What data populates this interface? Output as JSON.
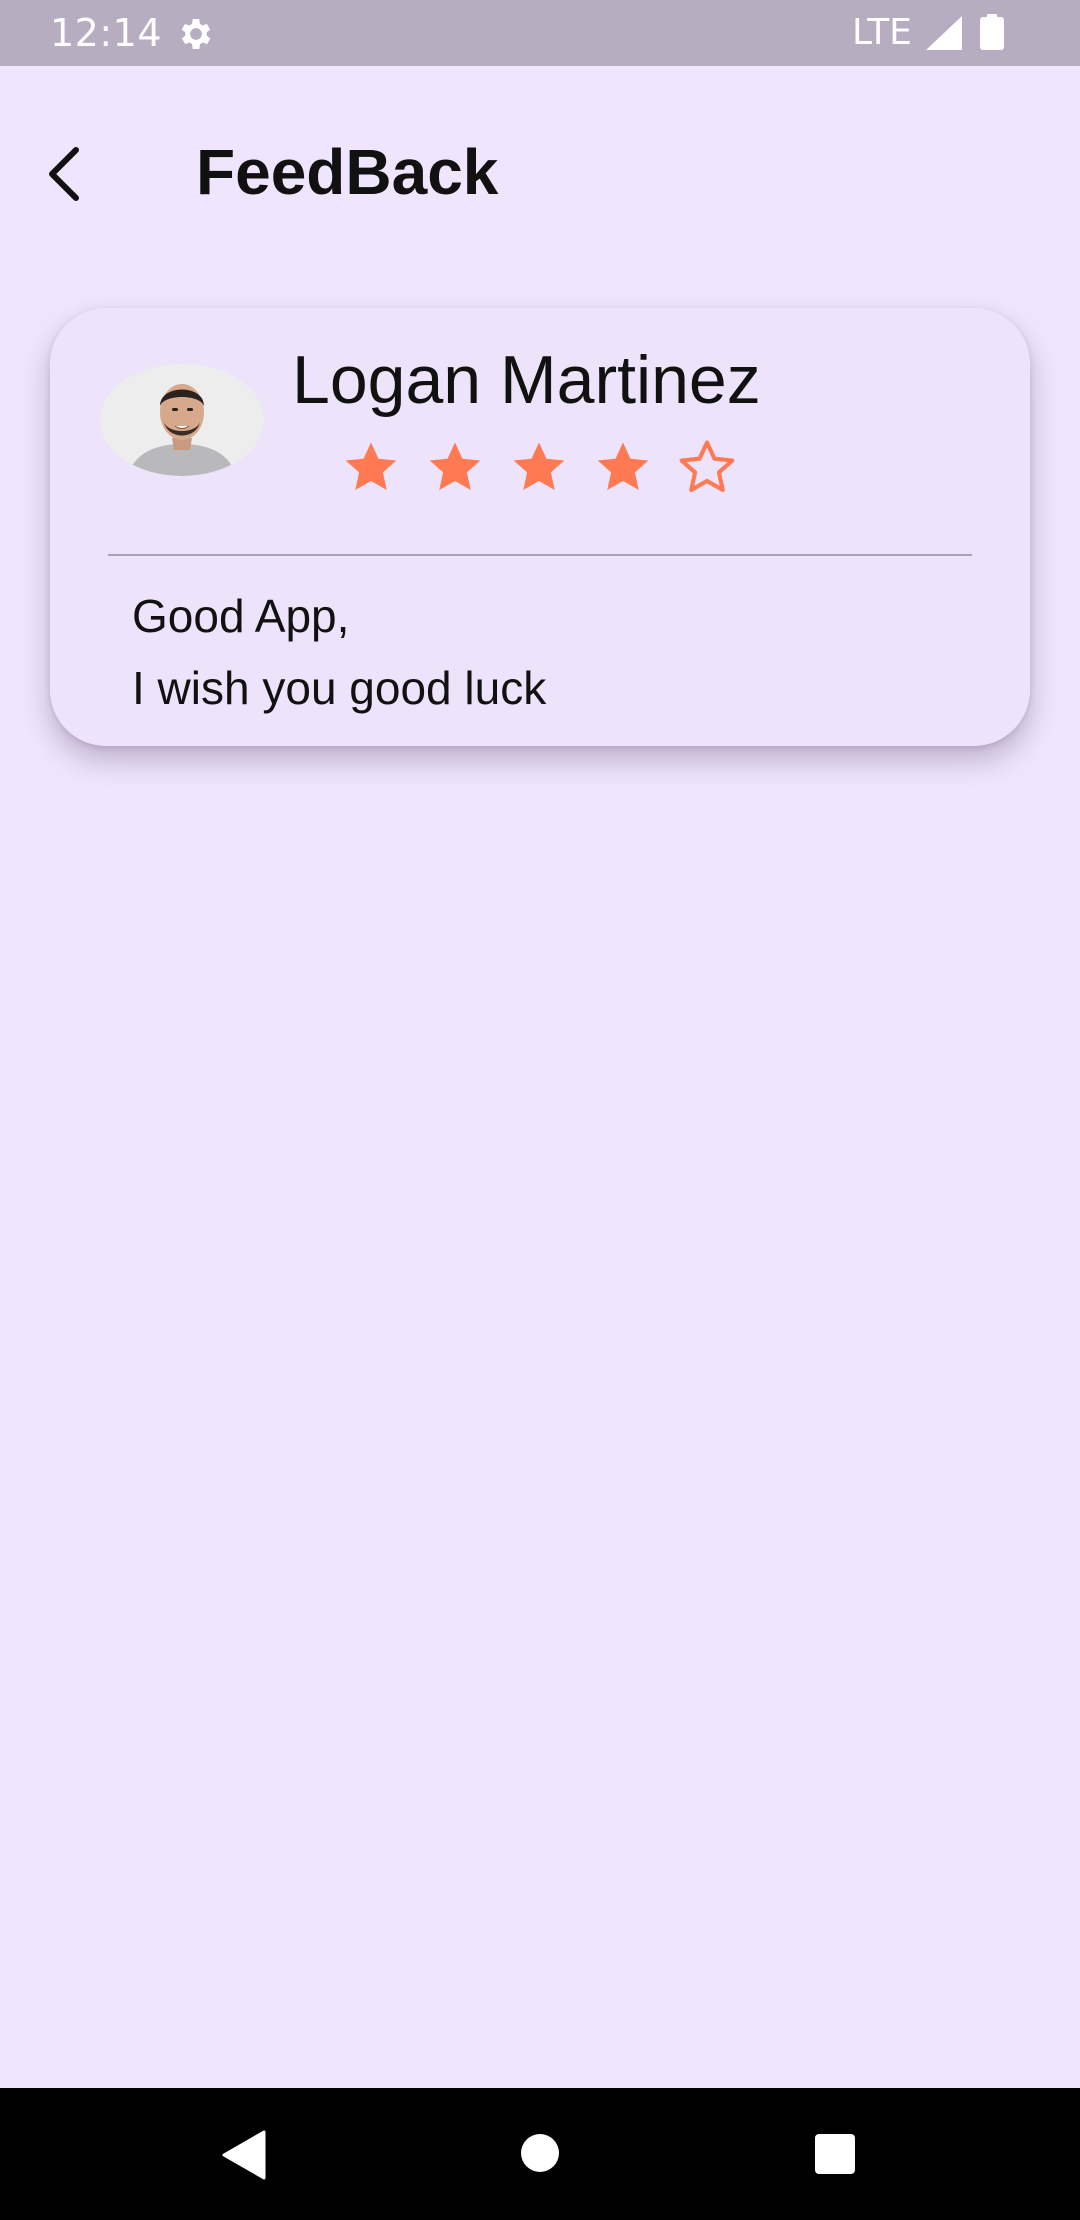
{
  "status_bar": {
    "time": "12:14",
    "network": "LTE",
    "icons": [
      "settings-gear-icon",
      "cell-signal-icon",
      "battery-icon"
    ]
  },
  "app_bar": {
    "title": "FeedBack",
    "back_icon": "chevron-left-icon"
  },
  "feedback": {
    "reviewer_name": "Logan Martinez",
    "rating": 4,
    "rating_max": 5,
    "comment_line1": "Good App,",
    "comment_line2": "I wish you good luck"
  },
  "nav_bar": {
    "icons": [
      "nav-back-icon",
      "nav-home-icon",
      "nav-recents-icon"
    ]
  },
  "colors": {
    "background": "#EFE5FD",
    "status_bar": "#B6ADC0",
    "card": "#EDE3FA",
    "star": "#FF7A52",
    "text": "#111111"
  }
}
